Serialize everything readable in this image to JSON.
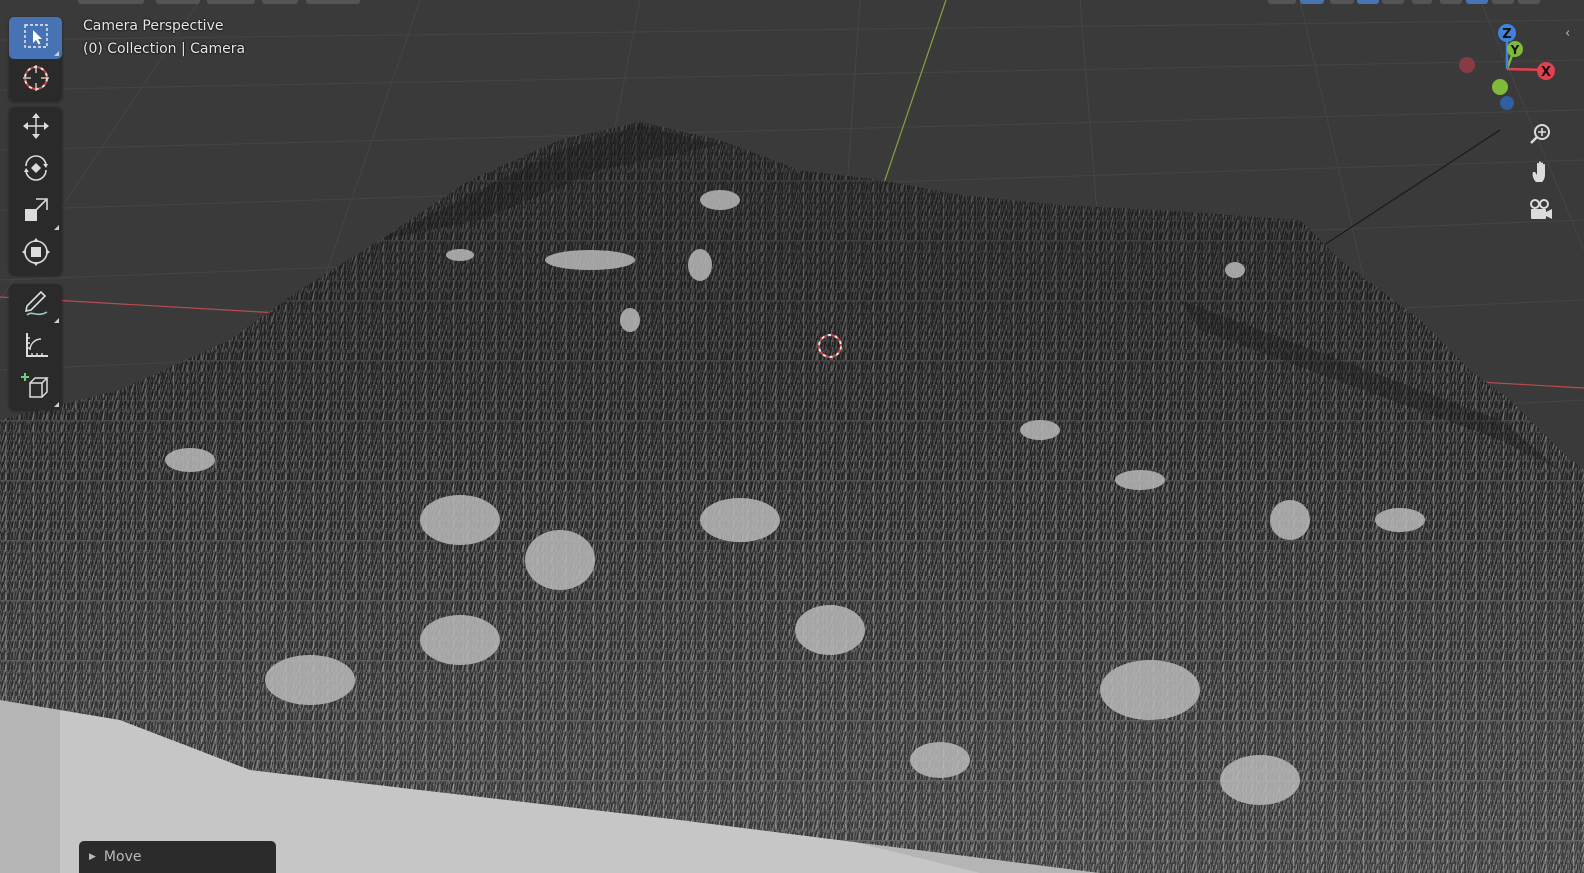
{
  "viewport": {
    "title": "Camera Perspective",
    "collection": "(0) Collection | Camera",
    "background": "#3a3a3a",
    "grid_color": "#454545",
    "x_axis_color": "#b84c4c",
    "y_axis_color": "#7fa63b"
  },
  "toolbar": {
    "active_color": "#4772b3",
    "tools": [
      {
        "name": "select-box",
        "icon": "select-box-icon",
        "active": true
      },
      {
        "name": "cursor",
        "icon": "cursor-icon",
        "active": false
      },
      {
        "name": "move",
        "icon": "move-icon",
        "active": false
      },
      {
        "name": "rotate",
        "icon": "rotate-icon",
        "active": false
      },
      {
        "name": "scale",
        "icon": "scale-icon",
        "active": false
      },
      {
        "name": "transform",
        "icon": "transform-icon",
        "active": false
      },
      {
        "name": "annotate",
        "icon": "annotate-icon",
        "active": false
      },
      {
        "name": "measure",
        "icon": "measure-icon",
        "active": false
      },
      {
        "name": "add-cube",
        "icon": "add-cube-icon",
        "active": false
      }
    ]
  },
  "gizmo": {
    "x_label": "X",
    "y_label": "Y",
    "z_label": "Z",
    "x_color": "#e0404f",
    "y_color": "#7fba3a",
    "z_color": "#3f83db"
  },
  "nav_buttons": [
    {
      "name": "zoom",
      "icon": "zoom-icon"
    },
    {
      "name": "pan",
      "icon": "hand-icon"
    },
    {
      "name": "camera-view",
      "icon": "camera-icon"
    }
  ],
  "operator_panel": {
    "label": "Move",
    "collapsed": true
  }
}
